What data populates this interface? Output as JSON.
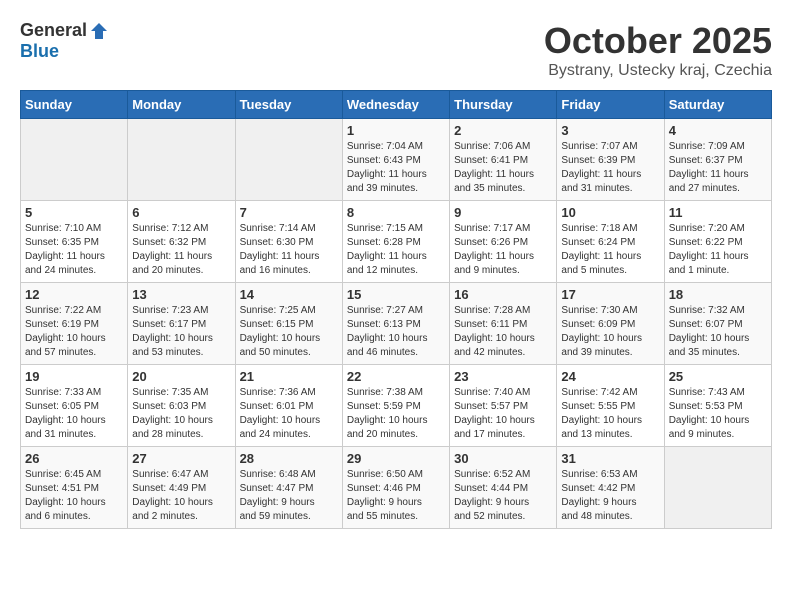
{
  "header": {
    "logo_general": "General",
    "logo_blue": "Blue",
    "title": "October 2025",
    "location": "Bystrany, Ustecky kraj, Czechia"
  },
  "weekdays": [
    "Sunday",
    "Monday",
    "Tuesday",
    "Wednesday",
    "Thursday",
    "Friday",
    "Saturday"
  ],
  "weeks": [
    [
      {
        "day": "",
        "info": ""
      },
      {
        "day": "",
        "info": ""
      },
      {
        "day": "",
        "info": ""
      },
      {
        "day": "1",
        "info": "Sunrise: 7:04 AM\nSunset: 6:43 PM\nDaylight: 11 hours\nand 39 minutes."
      },
      {
        "day": "2",
        "info": "Sunrise: 7:06 AM\nSunset: 6:41 PM\nDaylight: 11 hours\nand 35 minutes."
      },
      {
        "day": "3",
        "info": "Sunrise: 7:07 AM\nSunset: 6:39 PM\nDaylight: 11 hours\nand 31 minutes."
      },
      {
        "day": "4",
        "info": "Sunrise: 7:09 AM\nSunset: 6:37 PM\nDaylight: 11 hours\nand 27 minutes."
      }
    ],
    [
      {
        "day": "5",
        "info": "Sunrise: 7:10 AM\nSunset: 6:35 PM\nDaylight: 11 hours\nand 24 minutes."
      },
      {
        "day": "6",
        "info": "Sunrise: 7:12 AM\nSunset: 6:32 PM\nDaylight: 11 hours\nand 20 minutes."
      },
      {
        "day": "7",
        "info": "Sunrise: 7:14 AM\nSunset: 6:30 PM\nDaylight: 11 hours\nand 16 minutes."
      },
      {
        "day": "8",
        "info": "Sunrise: 7:15 AM\nSunset: 6:28 PM\nDaylight: 11 hours\nand 12 minutes."
      },
      {
        "day": "9",
        "info": "Sunrise: 7:17 AM\nSunset: 6:26 PM\nDaylight: 11 hours\nand 9 minutes."
      },
      {
        "day": "10",
        "info": "Sunrise: 7:18 AM\nSunset: 6:24 PM\nDaylight: 11 hours\nand 5 minutes."
      },
      {
        "day": "11",
        "info": "Sunrise: 7:20 AM\nSunset: 6:22 PM\nDaylight: 11 hours\nand 1 minute."
      }
    ],
    [
      {
        "day": "12",
        "info": "Sunrise: 7:22 AM\nSunset: 6:19 PM\nDaylight: 10 hours\nand 57 minutes."
      },
      {
        "day": "13",
        "info": "Sunrise: 7:23 AM\nSunset: 6:17 PM\nDaylight: 10 hours\nand 53 minutes."
      },
      {
        "day": "14",
        "info": "Sunrise: 7:25 AM\nSunset: 6:15 PM\nDaylight: 10 hours\nand 50 minutes."
      },
      {
        "day": "15",
        "info": "Sunrise: 7:27 AM\nSunset: 6:13 PM\nDaylight: 10 hours\nand 46 minutes."
      },
      {
        "day": "16",
        "info": "Sunrise: 7:28 AM\nSunset: 6:11 PM\nDaylight: 10 hours\nand 42 minutes."
      },
      {
        "day": "17",
        "info": "Sunrise: 7:30 AM\nSunset: 6:09 PM\nDaylight: 10 hours\nand 39 minutes."
      },
      {
        "day": "18",
        "info": "Sunrise: 7:32 AM\nSunset: 6:07 PM\nDaylight: 10 hours\nand 35 minutes."
      }
    ],
    [
      {
        "day": "19",
        "info": "Sunrise: 7:33 AM\nSunset: 6:05 PM\nDaylight: 10 hours\nand 31 minutes."
      },
      {
        "day": "20",
        "info": "Sunrise: 7:35 AM\nSunset: 6:03 PM\nDaylight: 10 hours\nand 28 minutes."
      },
      {
        "day": "21",
        "info": "Sunrise: 7:36 AM\nSunset: 6:01 PM\nDaylight: 10 hours\nand 24 minutes."
      },
      {
        "day": "22",
        "info": "Sunrise: 7:38 AM\nSunset: 5:59 PM\nDaylight: 10 hours\nand 20 minutes."
      },
      {
        "day": "23",
        "info": "Sunrise: 7:40 AM\nSunset: 5:57 PM\nDaylight: 10 hours\nand 17 minutes."
      },
      {
        "day": "24",
        "info": "Sunrise: 7:42 AM\nSunset: 5:55 PM\nDaylight: 10 hours\nand 13 minutes."
      },
      {
        "day": "25",
        "info": "Sunrise: 7:43 AM\nSunset: 5:53 PM\nDaylight: 10 hours\nand 9 minutes."
      }
    ],
    [
      {
        "day": "26",
        "info": "Sunrise: 6:45 AM\nSunset: 4:51 PM\nDaylight: 10 hours\nand 6 minutes."
      },
      {
        "day": "27",
        "info": "Sunrise: 6:47 AM\nSunset: 4:49 PM\nDaylight: 10 hours\nand 2 minutes."
      },
      {
        "day": "28",
        "info": "Sunrise: 6:48 AM\nSunset: 4:47 PM\nDaylight: 9 hours\nand 59 minutes."
      },
      {
        "day": "29",
        "info": "Sunrise: 6:50 AM\nSunset: 4:46 PM\nDaylight: 9 hours\nand 55 minutes."
      },
      {
        "day": "30",
        "info": "Sunrise: 6:52 AM\nSunset: 4:44 PM\nDaylight: 9 hours\nand 52 minutes."
      },
      {
        "day": "31",
        "info": "Sunrise: 6:53 AM\nSunset: 4:42 PM\nDaylight: 9 hours\nand 48 minutes."
      },
      {
        "day": "",
        "info": ""
      }
    ]
  ]
}
